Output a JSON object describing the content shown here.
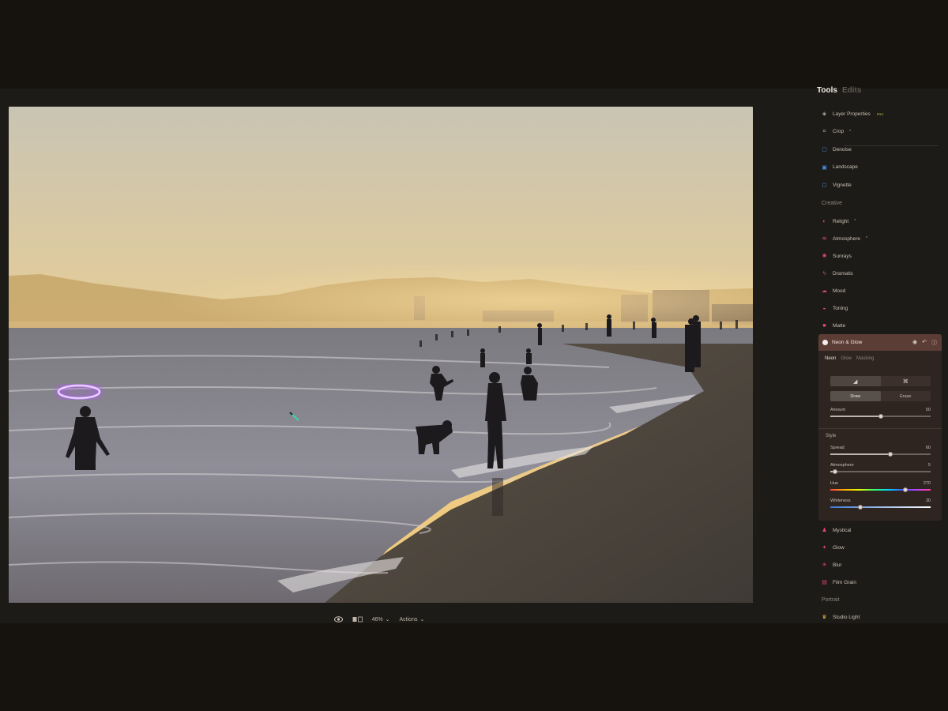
{
  "panel": {
    "tab_tools": "Tools",
    "tab_edits": "Edits",
    "essentials": [
      {
        "label": "Layer Properties",
        "badge": "PRO",
        "icon": "layers-icon",
        "color": "#b8b0a4"
      },
      {
        "label": "Crop",
        "badge": "*",
        "icon": "crop-icon",
        "color": "#b8b0a4"
      },
      {
        "label": "Denoise",
        "icon": "denoise-icon",
        "color": "#4a8fe8"
      },
      {
        "label": "Landscape",
        "icon": "landscape-icon",
        "color": "#4a8fe8"
      },
      {
        "label": "Vignette",
        "icon": "vignette-icon",
        "color": "#4a8fe8"
      }
    ],
    "section_creative": "Creative",
    "creative": [
      {
        "label": "Relight",
        "badge": "*",
        "icon": "relight-icon",
        "color": "#e0467d"
      },
      {
        "label": "Atmosphere",
        "badge": "*",
        "icon": "atmosphere-icon",
        "color": "#e0467d"
      },
      {
        "label": "Sunrays",
        "icon": "sunrays-icon",
        "color": "#e0467d"
      },
      {
        "label": "Dramatic",
        "icon": "dramatic-icon",
        "color": "#e0467d"
      },
      {
        "label": "Mood",
        "icon": "mood-icon",
        "color": "#e0467d"
      },
      {
        "label": "Toning",
        "icon": "toning-icon",
        "color": "#e0467d"
      },
      {
        "label": "Matte",
        "icon": "matte-icon",
        "color": "#e0467d"
      }
    ],
    "creative_after": [
      {
        "label": "Mystical",
        "icon": "mystical-icon",
        "color": "#e0467d"
      },
      {
        "label": "Glow",
        "icon": "glow-icon",
        "color": "#e0467d"
      },
      {
        "label": "Blur",
        "icon": "blur-icon",
        "color": "#e0467d"
      },
      {
        "label": "Film Grain",
        "icon": "film-grain-icon",
        "color": "#e0467d"
      }
    ],
    "section_portrait": "Portrait",
    "portrait": [
      {
        "label": "Studio Light",
        "icon": "studio-light-icon",
        "color": "#e8b838"
      }
    ]
  },
  "neon": {
    "title": "Neon & Glow",
    "subtabs": [
      "Neon",
      "Glow",
      "Masking"
    ],
    "mode_draw": "Draw",
    "mode_erase": "Erase",
    "amount": {
      "label": "Amount",
      "value": "50",
      "level": 0.5
    },
    "style_label": "Style",
    "spread": {
      "label": "Spread",
      "value": "60",
      "level": 0.6
    },
    "atmosphere": {
      "label": "Atmosphere",
      "value": "5",
      "level": 0.05
    },
    "hue": {
      "label": "Hue",
      "value": "270",
      "level": 0.75
    },
    "whiteness": {
      "label": "Whiteness",
      "value": "30",
      "level": 0.3
    }
  },
  "bottom": {
    "zoom": "46%",
    "actions": "Actions"
  },
  "colors": {
    "accent_blue": "#4a8fe8",
    "accent_pink": "#e0467d",
    "neon_halo": "#b455ff"
  }
}
